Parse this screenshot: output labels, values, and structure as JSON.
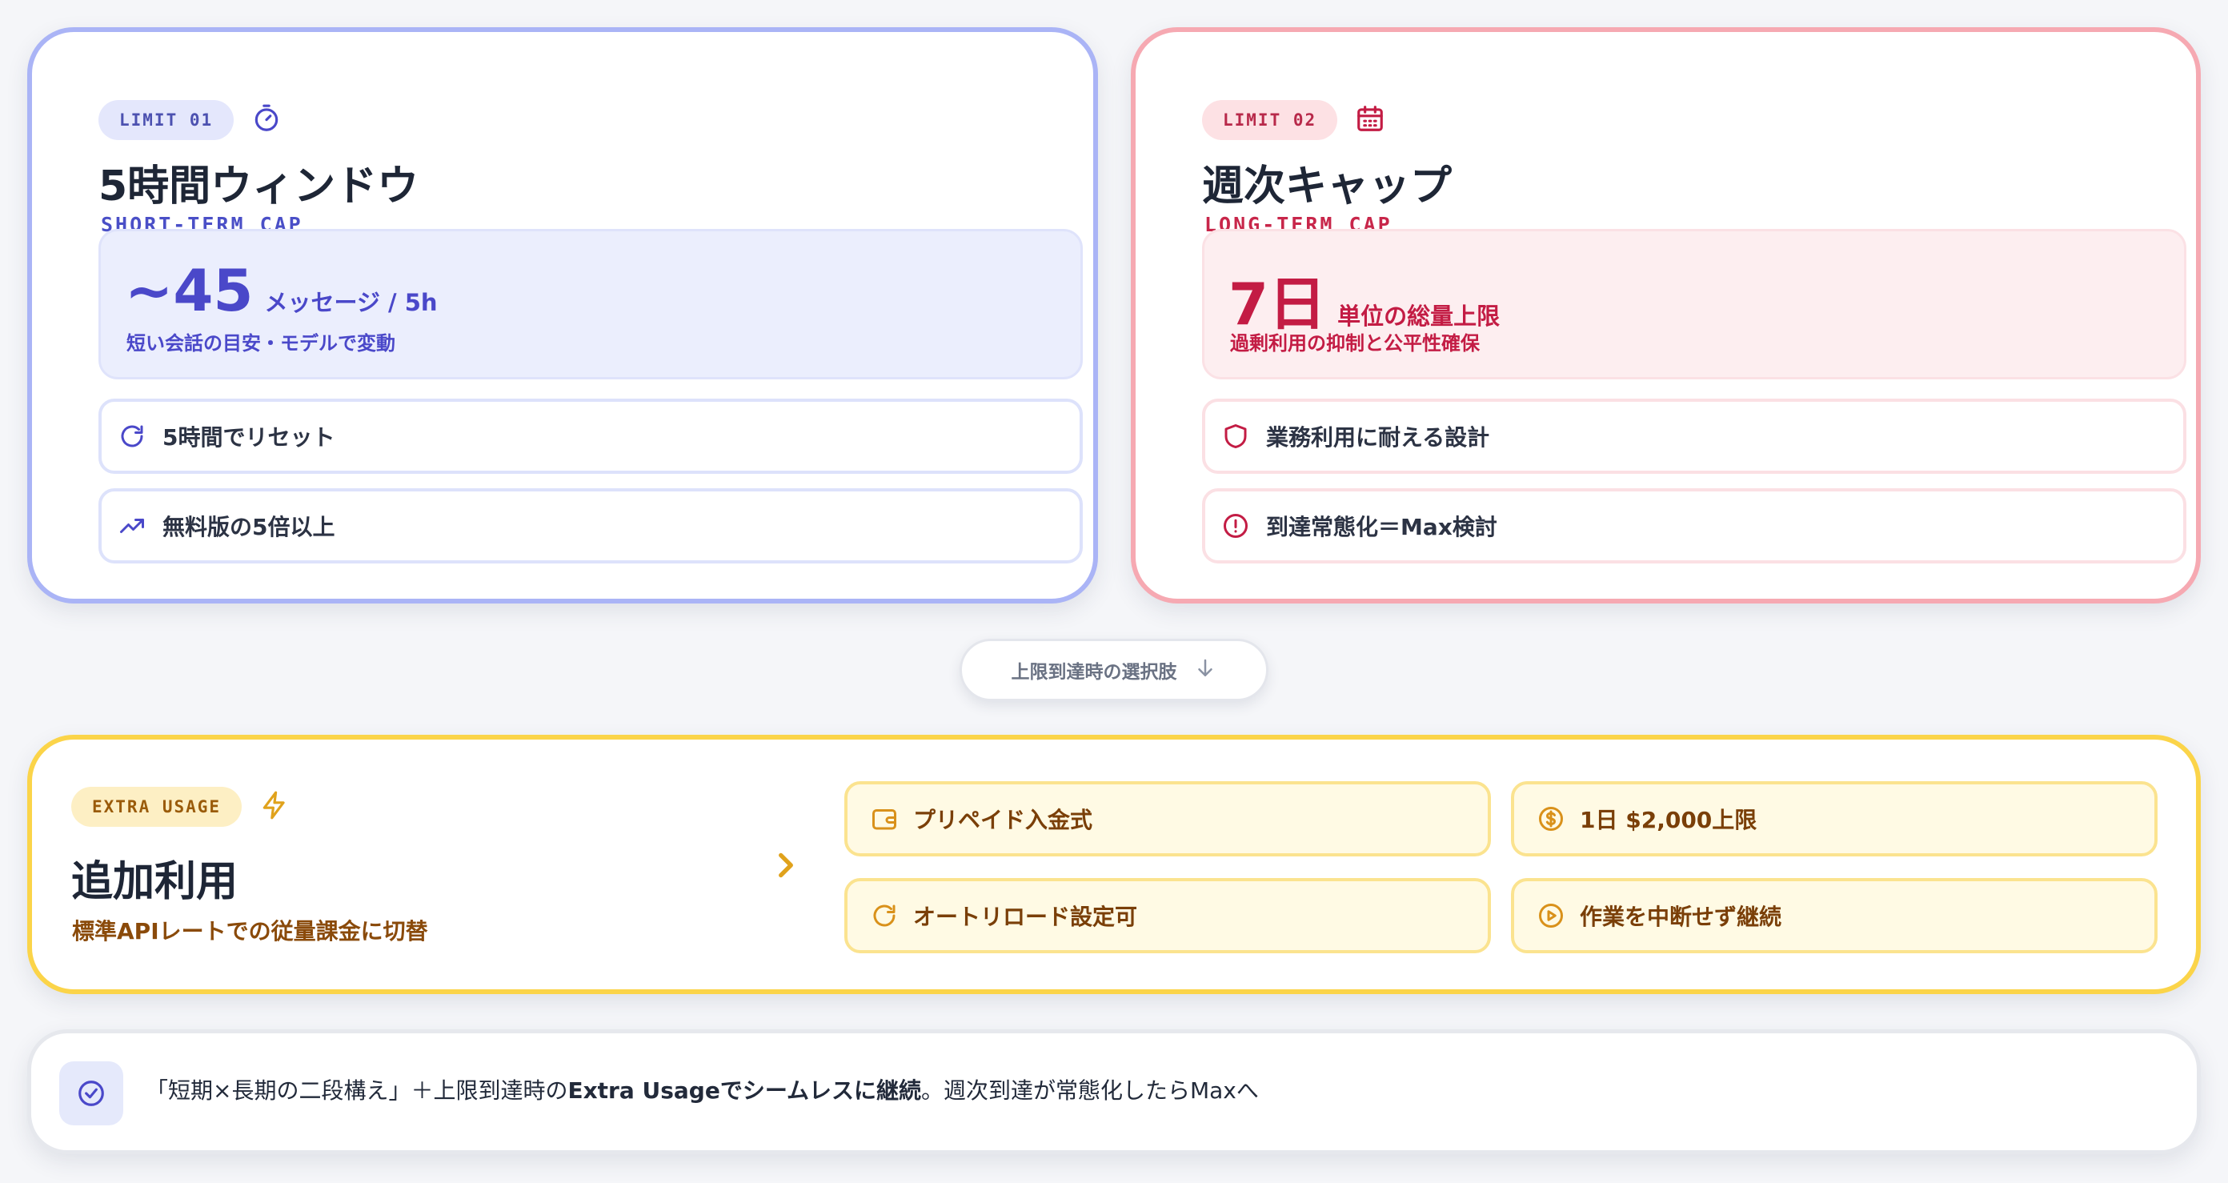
{
  "colors": {
    "blue": "#4a48c9",
    "pink": "#c31c44",
    "amber": "#e0a21c",
    "blue_border": "#aab4f6",
    "pink_border": "#f6a9b2",
    "amber_border": "#fbd449"
  },
  "short_term": {
    "tag": "LIMIT 01",
    "tag_icon": "stopwatch-icon",
    "title": "5時間ウィンドウ",
    "subtitle": "SHORT-TERM CAP",
    "stat_value": "~45",
    "stat_unit": "メッセージ / 5h",
    "stat_note": "短い会話の目安・モデルで変動",
    "features": [
      {
        "icon": "refresh-icon",
        "label": "5時間でリセット"
      },
      {
        "icon": "trending-up-icon",
        "label": "無料版の5倍以上"
      }
    ]
  },
  "long_term": {
    "tag": "LIMIT 02",
    "tag_icon": "calendar-icon",
    "title": "週次キャップ",
    "subtitle": "LONG-TERM CAP",
    "stat_value": "7日",
    "stat_unit": "単位の総量上限",
    "stat_note": "過剰利用の抑制と公平性確保",
    "features": [
      {
        "icon": "shield-icon",
        "label": "業務利用に耐える設計"
      },
      {
        "icon": "alert-circle-icon",
        "label": "到達常態化＝Max検討"
      }
    ]
  },
  "connector": {
    "label": "上限到達時の選択肢",
    "icon": "arrow-down-icon"
  },
  "extra": {
    "tag": "EXTRA USAGE",
    "tag_icon": "lightning-icon",
    "title": "追加利用",
    "description": "標準APIレートでの従量課金に切替",
    "options": [
      {
        "icon": "wallet-icon",
        "label": "プリペイド入金式"
      },
      {
        "icon": "dollar-circle-icon",
        "label": "1日 $2,000上限"
      },
      {
        "icon": "refresh-icon",
        "label": "オートリロード設定可"
      },
      {
        "icon": "play-circle-icon",
        "label": "作業を中断せず継続"
      }
    ]
  },
  "summary": {
    "icon": "check-circle-icon",
    "part1": "「短期×長期の二段構え」＋上限到達時の",
    "part2": "Extra Usageでシームレスに継続",
    "part3": "。週次到達が常態化したらMaxへ"
  }
}
